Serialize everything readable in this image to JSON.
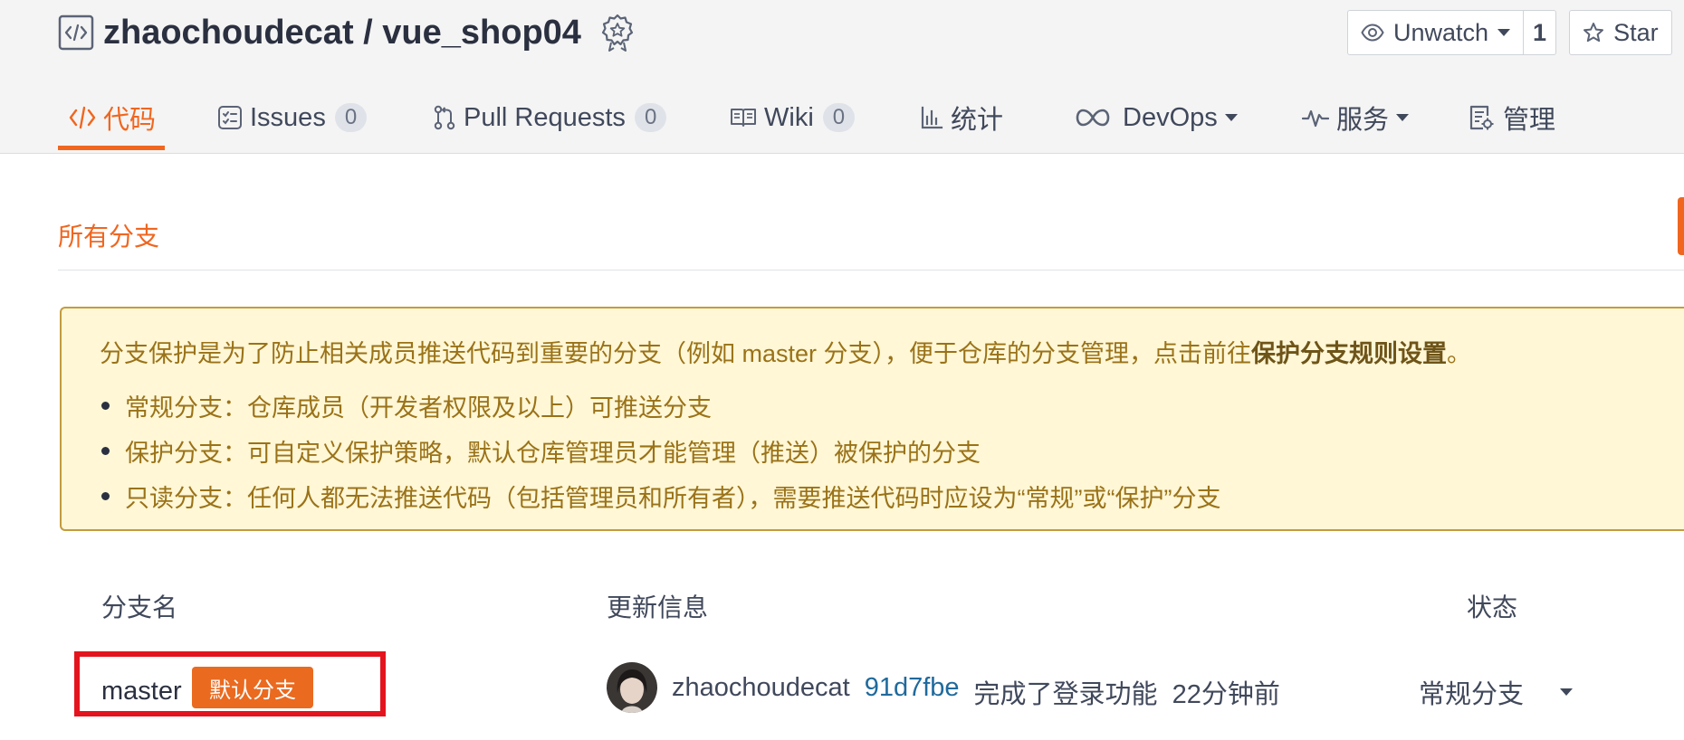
{
  "repo": {
    "owner": "zhaochoudecat",
    "name": "vue_shop04",
    "full_title": "zhaochoudecat / vue_shop04"
  },
  "actions": {
    "watch_label": "Unwatch",
    "watch_count": "1",
    "star_label": "Star"
  },
  "tabs": [
    {
      "label": "代码",
      "icon": "code-icon",
      "active": true
    },
    {
      "label": "Issues",
      "count": "0",
      "icon": "issues-icon"
    },
    {
      "label": "Pull Requests",
      "count": "0",
      "icon": "pull-request-icon"
    },
    {
      "label": "Wiki",
      "count": "0",
      "icon": "book-icon"
    },
    {
      "label": "统计",
      "icon": "bar-chart-icon"
    },
    {
      "label": "DevOps",
      "icon": "infinity-icon",
      "dropdown": true
    },
    {
      "label": "服务",
      "icon": "pulse-icon",
      "dropdown": true
    },
    {
      "label": "管理",
      "icon": "settings-document-icon"
    }
  ],
  "section_title": "所有分支",
  "notice": {
    "intro": "分支保护是为了防止相关成员推送代码到重要的分支（例如 master 分支），便于仓库的分支管理，点击前往",
    "link": "保护分支规则设置",
    "intro_end": "。",
    "items": [
      "常规分支：仓库成员（开发者权限及以上）可推送分支",
      "保护分支：可自定义保护策略，默认仓库管理员才能管理（推送）被保护的分支",
      "只读分支：任何人都无法推送代码（包括管理员和所有者），需要推送代码时应设为“常规”或“保护”分支"
    ]
  },
  "table": {
    "headers": {
      "branch": "分支名",
      "update": "更新信息",
      "status": "状态"
    },
    "rows": [
      {
        "branch": "master",
        "badge": "默认分支",
        "author": "zhaochoudecat",
        "sha": "91d7fbe",
        "message": "完成了登录功能",
        "time": "22分钟前",
        "status": "常规分支"
      }
    ]
  },
  "colors": {
    "accent": "#f0661f",
    "notice_bg": "#fff7d6",
    "notice_text": "#9a7218",
    "highlight_border": "#e4141e",
    "sha_link": "#1f6a9d"
  }
}
